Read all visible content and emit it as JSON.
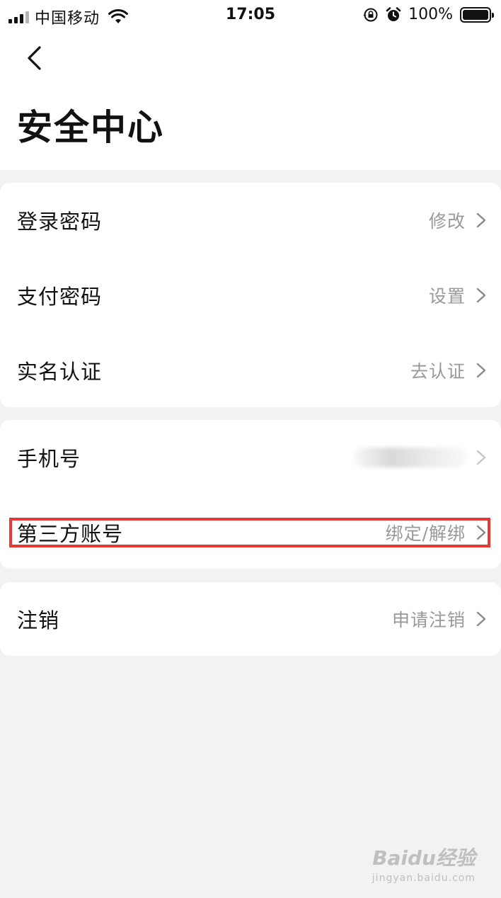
{
  "status_bar": {
    "carrier": "中国移动",
    "time": "17:05",
    "battery": "100%",
    "icons": [
      "signal-icon",
      "wifi-icon",
      "rotation-lock-icon",
      "alarm-icon",
      "battery-icon"
    ]
  },
  "header": {
    "back_icon": "chevron-left-icon",
    "title": "安全中心"
  },
  "groups": [
    {
      "items": [
        {
          "label": "登录密码",
          "value": "修改"
        },
        {
          "label": "支付密码",
          "value": "设置"
        },
        {
          "label": "实名认证",
          "value": "去认证"
        }
      ]
    },
    {
      "items": [
        {
          "label": "手机号",
          "value": ""
        },
        {
          "label": "第三方账号",
          "value": "绑定/解绑"
        }
      ]
    },
    {
      "items": [
        {
          "label": "注销",
          "value": "申请注销"
        }
      ]
    }
  ],
  "annotation": {
    "highlight_color": "#e53935"
  },
  "watermark": {
    "logo": "Baidu经验",
    "url": "jingyan.baidu.com"
  },
  "colors": {
    "background": "#f2f2f2",
    "card": "#ffffff",
    "secondary_text": "#999999"
  }
}
